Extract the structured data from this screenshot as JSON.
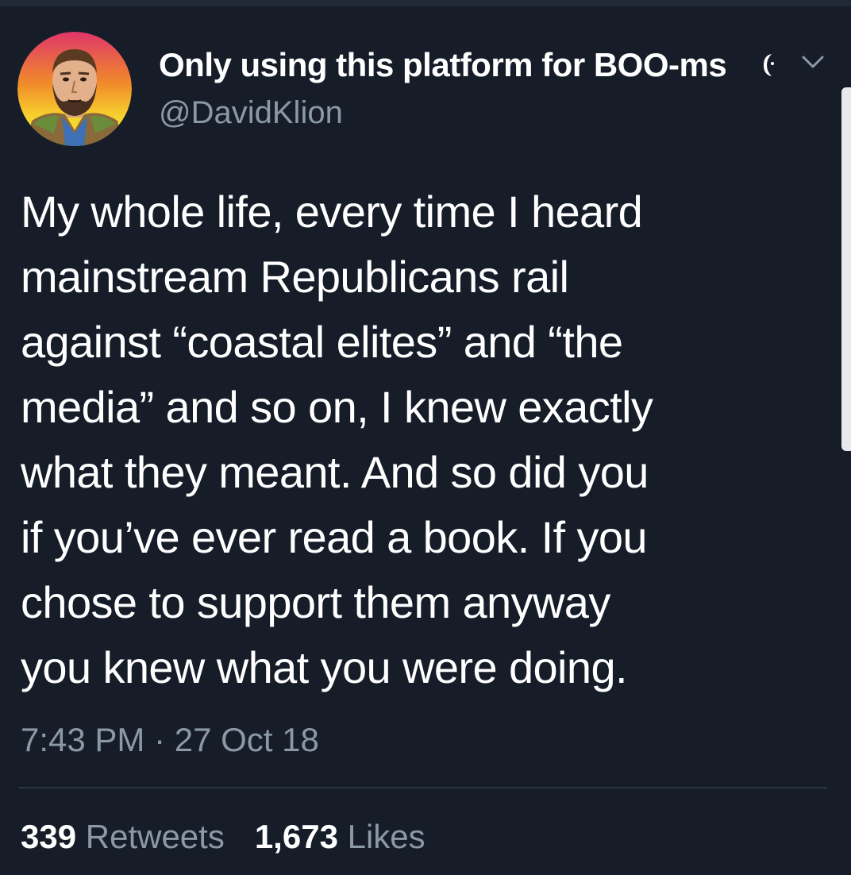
{
  "author": {
    "display_name": "Only using this platform for BOO-ms",
    "handle": "@DavidKlion",
    "avatar_icon": "bearded-man-avatar"
  },
  "tweet": {
    "text": "My whole life, every time I heard\nmainstream Republicans rail\nagainst “coastal elites” and “the\nmedia” and so on, I knew exactly\nwhat they meant. And so did you\nif you’ve ever read a book. If you\nchose to support them anyway\nyou knew what you were doing.",
    "time": "7:43 PM",
    "separator": " · ",
    "date": "27 Oct 18"
  },
  "stats": {
    "retweets_count": "339",
    "retweets_label": "Retweets",
    "likes_count": "1,673",
    "likes_label": "Likes"
  },
  "colors": {
    "background": "#161d29",
    "primary_text": "#ffffff",
    "secondary_text": "#8b98a6",
    "divider": "#2c3642"
  }
}
